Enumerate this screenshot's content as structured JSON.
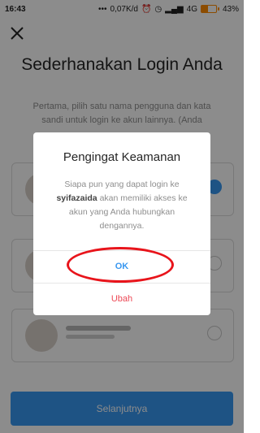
{
  "status_bar": {
    "time": "16:43",
    "network_speed": "0,07K/d",
    "network_type": "4G",
    "battery_percent": "43%",
    "battery_level": 0.43,
    "icons": [
      "more-dots-icon",
      "alarm-icon",
      "clock-icon",
      "signal-icon",
      "battery-icon"
    ]
  },
  "header": {
    "close_icon": "close-icon",
    "title": "Sederhanakan Login Anda",
    "subtitle": "Pertama, pilih satu nama pengguna dan kata sandi untuk login ke akun lainnya. (Anda"
  },
  "accounts": [
    {
      "selected": true
    },
    {
      "selected": false
    },
    {
      "selected": false
    }
  ],
  "footer": {
    "next_label": "Selanjutnya"
  },
  "dialog": {
    "title": "Pengingat Keamanan",
    "message_pre": "Siapa pun yang dapat login ke",
    "username": "syifazaida",
    "message_post": "akan memiliki akses ke akun yang Anda hubungkan dengannya.",
    "ok_label": "OK",
    "change_label": "Ubah"
  },
  "colors": {
    "accent": "#3897f0",
    "danger": "#ed4956",
    "highlight_circle": "#e8141b"
  }
}
